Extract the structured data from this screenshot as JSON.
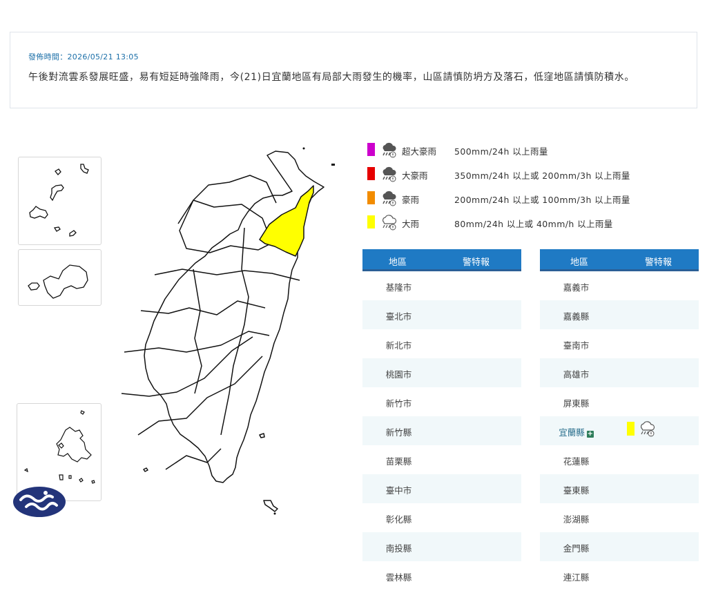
{
  "notice": {
    "time_text": "發佈時間：2026/05/21 13:05",
    "message": "午後對流雲系發展旺盛，易有短延時強降雨，今(21)日宜蘭地區有局部大雨發生的機率，山區請慎防坍方及落石，低窪地區請慎防積水。"
  },
  "legend": [
    {
      "name": "超大豪雨",
      "desc": "500mm/24h 以上雨量",
      "color": "#cc00cc",
      "icon": "heavy-rain-thunder-icon"
    },
    {
      "name": "大豪雨",
      "desc": "350mm/24h 以上或 200mm/3h 以上雨量",
      "color": "#e60000",
      "icon": "heavy-rain-thunder-icon"
    },
    {
      "name": "豪雨",
      "desc": "200mm/24h 以上或 100mm/3h 以上雨量",
      "color": "#f28c00",
      "icon": "heavy-rain-thunder-icon"
    },
    {
      "name": "大雨",
      "desc": "80mm/24h 以上或 40mm/h 以上雨量",
      "color": "#ffff00",
      "icon": "rain-cloud-icon"
    }
  ],
  "table_headers": {
    "region": "地區",
    "warning": "警特報"
  },
  "left_regions": [
    "基隆市",
    "臺北市",
    "新北市",
    "桃園市",
    "新竹市",
    "新竹縣",
    "苗栗縣",
    "臺中市",
    "彰化縣",
    "南投縣",
    "雲林縣"
  ],
  "right_regions": [
    "嘉義市",
    "嘉義縣",
    "臺南市",
    "高雄市",
    "屏東縣",
    "宜蘭縣",
    "花蓮縣",
    "臺東縣",
    "澎湖縣",
    "金門縣",
    "連江縣"
  ],
  "active_warning": {
    "region": "宜蘭縣",
    "level": "大雨",
    "color": "#ffff00",
    "expand_symbol": "+"
  },
  "map": {
    "highlight_color": "#ffff00",
    "highlight_region": "宜蘭縣"
  }
}
